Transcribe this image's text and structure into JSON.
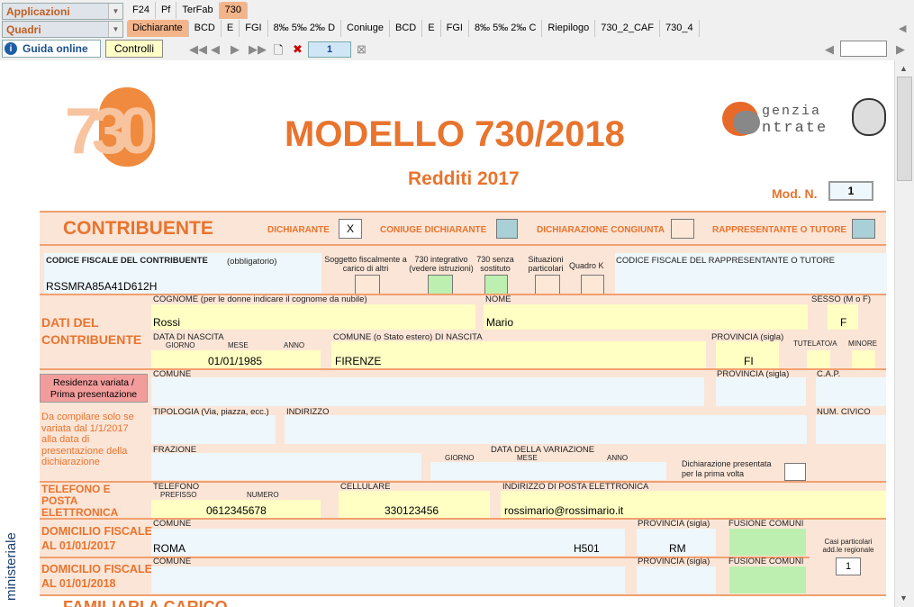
{
  "menus": {
    "applicazioni": "Applicazioni",
    "quadri": "Quadri"
  },
  "tabs_top": [
    "F24",
    "Pf",
    "TerFab",
    "730"
  ],
  "tabs_bottom": [
    "Dichiarante",
    "BCD",
    "E",
    "FGI",
    "8‰ 5‰ 2‰ D",
    "Coniuge",
    "BCD",
    "E",
    "FGI",
    "8‰ 5‰ 2‰ C",
    "Riepilogo",
    "730_2_CAF",
    "730_4"
  ],
  "toolbar": {
    "guida": "Guida online",
    "controlli": "Controlli",
    "page": "1"
  },
  "header": {
    "logo_num": "730",
    "title": "MODELLO 730/2018",
    "subtitle": "Redditi 2017",
    "agency_line1": "genzia",
    "agency_line2": "ntrate",
    "mod_label": "Mod. N.",
    "mod_value": "1"
  },
  "contribuente": {
    "title": "CONTRIBUENTE",
    "dichiarante": "DICHIARANTE",
    "dichiarante_val": "X",
    "coniuge": "CONIUGE DICHIARANTE",
    "congiunta": "DICHIARAZIONE CONGIUNTA",
    "rappresentante": "RAPPRESENTANTE O TUTORE",
    "cf_label": "CODICE FISCALE DEL CONTRIBUENTE",
    "cf_obbl": "(obbligatorio)",
    "cf_value": "RSSMRA85A41D612H",
    "soggetto": "Soggetto fiscalmente a carico di altri",
    "integrativo": "730 integrativo (vedere istruzioni)",
    "senza": "730 senza sostituto",
    "situazioni": "Situazioni particolari",
    "quadro_k": "Quadro K",
    "cf_rapp": "CODICE FISCALE DEL RAPPRESENTANTE O TUTORE"
  },
  "dati": {
    "title1": "DATI DEL",
    "title2": "CONTRIBUENTE",
    "cognome_label": "COGNOME (per le donne indicare il cognome da nubile)",
    "cognome": "Rossi",
    "nome_label": "NOME",
    "nome": "Mario",
    "sesso_label": "SESSO (M o F)",
    "sesso": "F",
    "nascita_label": "DATA DI NASCITA",
    "giorno": "GIORNO",
    "mese": "MESE",
    "anno": "ANNO",
    "nascita": "01/01/1985",
    "comune_nascita_label": "COMUNE (o Stato estero) DI NASCITA",
    "comune_nascita": "FIRENZE",
    "prov_label": "PROVINCIA (sigla)",
    "prov": "FI",
    "tutelato": "TUTELATO/A",
    "minore": "MINORE"
  },
  "residenza": {
    "button": "Residenza variata / Prima presentazione",
    "note": "Da compilare solo se variata dal 1/1/2017 alla data di presentazione della dichiarazione",
    "comune": "COMUNE",
    "provincia": "PROVINCIA (sigla)",
    "cap": "C.A.P.",
    "tipologia": "TIPOLOGIA (Via, piazza, ecc.)",
    "indirizzo": "INDIRIZZO",
    "civico": "NUM. CIVICO",
    "frazione": "FRAZIONE",
    "data_var": "DATA DELLA VARIAZIONE",
    "giorno": "GIORNO",
    "mese": "MESE",
    "anno": "ANNO",
    "prima_volta": "Dichiarazione presentata per la prima volta"
  },
  "telefono": {
    "title1": "TELEFONO E",
    "title2": "POSTA",
    "title3": "ELETTRONICA",
    "tel_label": "TELEFONO",
    "prefisso": "PREFISSO",
    "numero": "NUMERO",
    "tel": "0612345678",
    "cell_label": "CELLULARE",
    "cell": "330123456",
    "email_label": "INDIRIZZO DI POSTA ELETTRONICA",
    "email": "rossimario@rossimario.it"
  },
  "domicilio": {
    "title2017a": "DOMICILIO FISCALE",
    "title2017b": "AL 01/01/2017",
    "title2018a": "DOMICILIO FISCALE",
    "title2018b": "AL 01/01/2018",
    "comune": "COMUNE",
    "provincia": "PROVINCIA (sigla)",
    "fusione": "FUSIONE COMUNI",
    "comune_val": "ROMA",
    "codice": "H501",
    "prov_val": "RM",
    "casi": "Casi particolari add.le regionale",
    "casi_val": "1"
  },
  "footer": {
    "familiari": "FAMILIARI A CARICO",
    "ministeriale": "ministeriale"
  }
}
